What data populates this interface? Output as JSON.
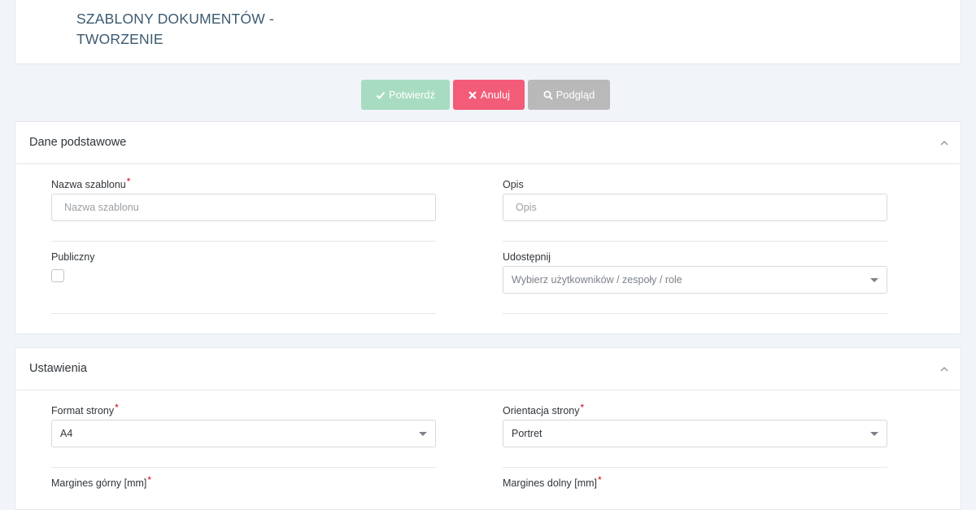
{
  "header": {
    "title": "SZABLONY DOKUMENTÓW - TWORZENIE"
  },
  "actions": {
    "confirm": "Potwierdź",
    "cancel": "Anuluj",
    "preview": "Podgląd"
  },
  "basic": {
    "title": "Dane podstawowe",
    "name_label": "Nazwa szablonu",
    "name_required": "*",
    "name_placeholder": "Nazwa szablonu",
    "desc_label": "Opis",
    "desc_placeholder": "Opis",
    "public_label": "Publiczny",
    "share_label": "Udostępnij",
    "share_placeholder": "Wybierz użytkowników / zespoły / role"
  },
  "settings": {
    "title": "Ustawienia",
    "format_label": "Format strony",
    "format_required": "*",
    "format_value": "A4",
    "orientation_label": "Orientacja strony",
    "orientation_required": "*",
    "orientation_value": "Portret",
    "margin_top_label": "Margines górny [mm]",
    "margin_top_required": "*",
    "margin_bottom_label": "Margines dolny [mm]",
    "margin_bottom_required": "*"
  },
  "colors": {
    "confirm": "#a8dcc2",
    "cancel": "#f25c78",
    "preview": "#b9b9b9",
    "title": "#3c5a70"
  }
}
